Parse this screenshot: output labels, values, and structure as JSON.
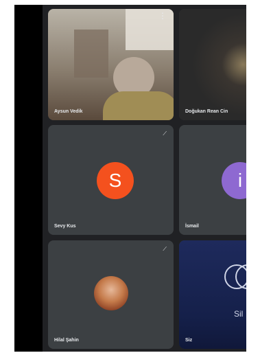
{
  "participants": [
    {
      "name": "Aysun Vedik",
      "status_icon": "more-icon"
    },
    {
      "name": "Doğukan Rean Cin"
    },
    {
      "name": "Sevy Kus",
      "initial": "S",
      "avatar_color": "#f4511e",
      "status_icon": "mic-off-icon"
    },
    {
      "name": "İsmail",
      "initial": "i",
      "avatar_color": "#8e69d1"
    },
    {
      "name": "Hilal Şahin",
      "status_icon": "mic-off-icon"
    },
    {
      "name": "Siz",
      "label_fragment": "Sil"
    }
  ],
  "icons": {
    "mic_off": "⟋",
    "more": "⋮"
  }
}
